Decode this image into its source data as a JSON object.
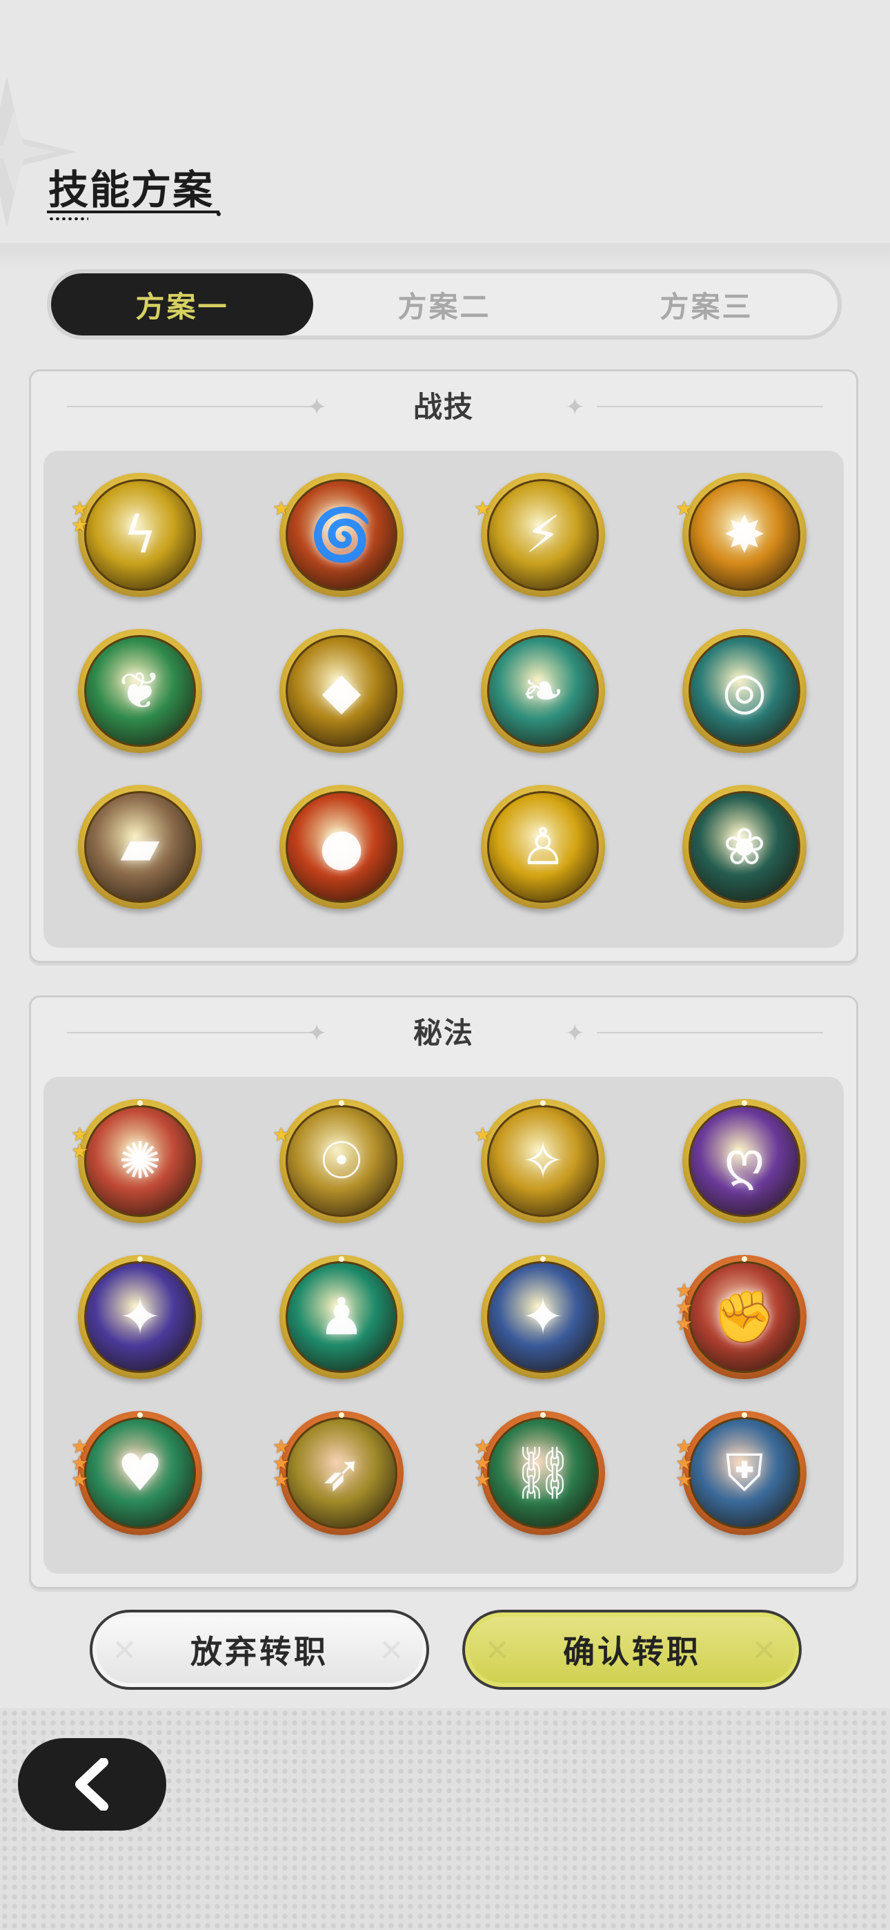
{
  "header": {
    "title": "技能方案"
  },
  "tabs": [
    {
      "label": "方案一",
      "active": true
    },
    {
      "label": "方案二",
      "active": false
    },
    {
      "label": "方案三",
      "active": false
    }
  ],
  "combat": {
    "title": "战技",
    "skills": [
      {
        "icon": "lightning-orb-icon",
        "stars": 2,
        "color": "#c9a21c"
      },
      {
        "icon": "fire-swirl-icon",
        "stars": 1,
        "color": "#b8461c"
      },
      {
        "icon": "lightning-slash-icon",
        "stars": 1,
        "color": "#caa11e"
      },
      {
        "icon": "light-burst-icon",
        "stars": 1,
        "color": "#d58a1a"
      },
      {
        "icon": "green-flame-icon",
        "stars": 0,
        "color": "#2f8a4c"
      },
      {
        "icon": "golden-crystal-icon",
        "stars": 0,
        "color": "#b08418"
      },
      {
        "icon": "teal-slash-icon",
        "stars": 0,
        "color": "#2f8f7c"
      },
      {
        "icon": "teal-vortex-icon",
        "stars": 0,
        "color": "#2a7b76"
      },
      {
        "icon": "rock-shield-icon",
        "stars": 0,
        "color": "#8a6a4a"
      },
      {
        "icon": "fireball-icon",
        "stars": 0,
        "color": "#c2401a"
      },
      {
        "icon": "golden-figure-icon",
        "stars": 0,
        "color": "#d4a412"
      },
      {
        "icon": "thorn-vine-icon",
        "stars": 0,
        "color": "#245d50"
      }
    ]
  },
  "arcane": {
    "title": "秘法",
    "skills": [
      {
        "icon": "fire-rune-icon",
        "stars": 2,
        "tier": "gold",
        "color": "#c04a36"
      },
      {
        "icon": "golden-aura-figure-icon",
        "stars": 1,
        "tier": "gold",
        "color": "#b4902a"
      },
      {
        "icon": "shatter-icon",
        "stars": 1,
        "tier": "gold",
        "color": "#c89a20"
      },
      {
        "icon": "purple-swirl-icon",
        "stars": 0,
        "tier": "gold",
        "color": "#6a3a9a"
      },
      {
        "icon": "starry-portal-icon",
        "stars": 0,
        "tier": "gold",
        "color": "#4a3a9a"
      },
      {
        "icon": "green-aura-figure-icon",
        "stars": 0,
        "tier": "gold",
        "color": "#1e8a6a"
      },
      {
        "icon": "blue-sparkle-icon",
        "stars": 0,
        "tier": "gold",
        "color": "#3a5a9a"
      },
      {
        "icon": "red-fist-icon",
        "stars": 3,
        "tier": "orange",
        "color": "#b04030"
      },
      {
        "icon": "heart-shield-icon",
        "stars": 3,
        "tier": "orange",
        "color": "#2a8a5a"
      },
      {
        "icon": "wing-boot-icon",
        "stars": 3,
        "tier": "orange",
        "color": "#a08a2a"
      },
      {
        "icon": "green-chain-icon",
        "stars": 3,
        "tier": "orange",
        "color": "#2a7a4a"
      },
      {
        "icon": "blue-armor-icon",
        "stars": 3,
        "tier": "orange",
        "color": "#3a6a9a"
      }
    ]
  },
  "actions": {
    "abandon": "放弃转职",
    "confirm": "确认转职"
  },
  "colors": {
    "accent": "#d6d162",
    "dark": "#1f1f1f"
  }
}
